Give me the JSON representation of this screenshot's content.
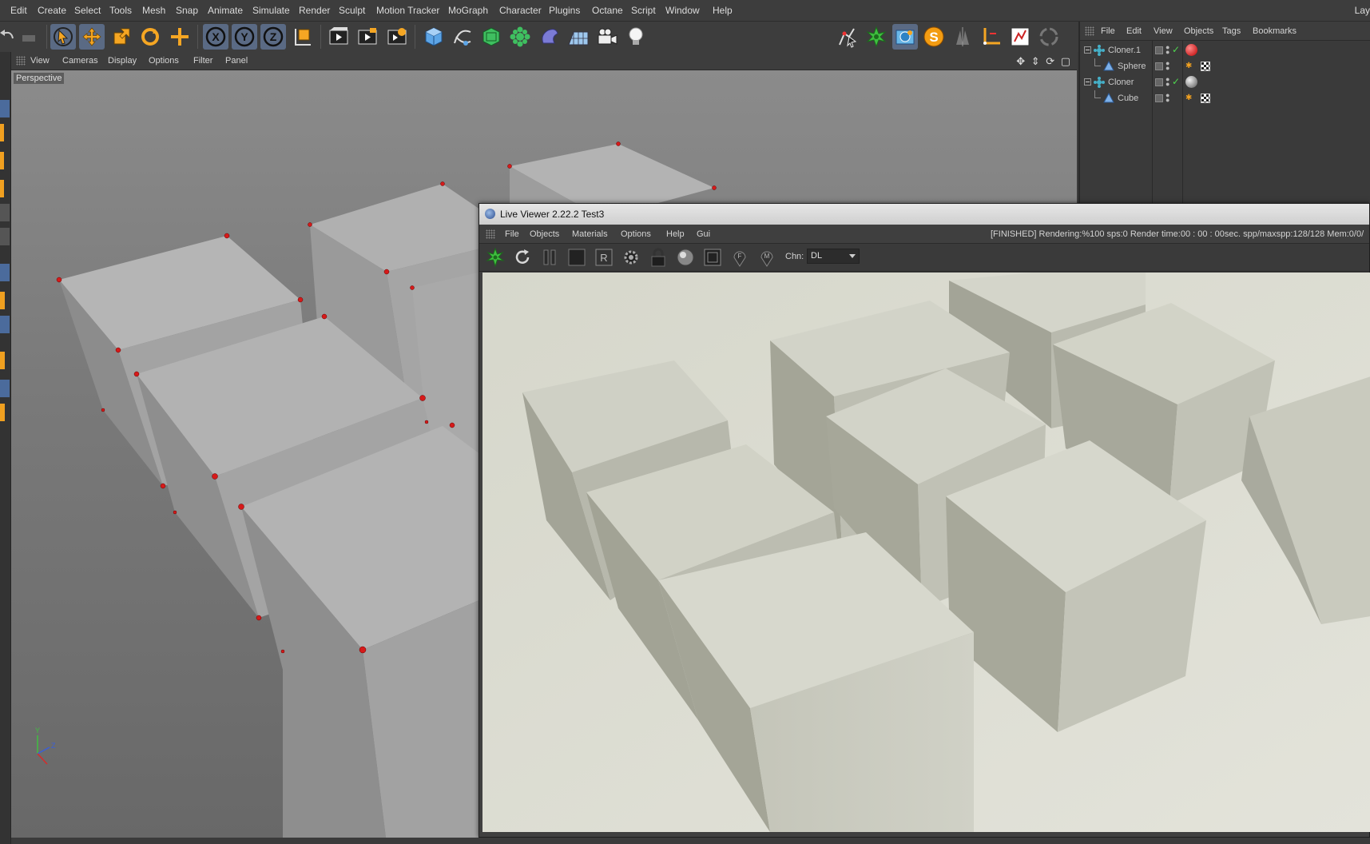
{
  "menubar": {
    "items": [
      "Edit",
      "Create",
      "Select",
      "Tools",
      "Mesh",
      "Snap",
      "Animate",
      "Simulate",
      "Render",
      "Sculpt",
      "Motion Tracker",
      "MoGraph",
      "Character",
      "Plugins",
      "Octane",
      "Script",
      "Window",
      "Help"
    ],
    "right_label": "Lay"
  },
  "toolbar": {
    "icons": [
      "undo-icon",
      "redo-icon",
      "live-selection-icon",
      "move-icon",
      "scale-icon",
      "rotate-icon",
      "add-object-icon",
      "x-axis-icon",
      "y-axis-icon",
      "z-axis-icon",
      "coordinate-system-icon",
      "render-view-icon",
      "render-picture-viewer-icon",
      "render-settings-icon",
      "cube-primitive-icon",
      "spline-pen-icon",
      "subdivision-surface-icon",
      "cloner-icon",
      "deformer-icon",
      "floor-icon",
      "camera-icon",
      "light-icon"
    ],
    "right_icons": [
      "tool-pointer-icon",
      "octane-live-viewer-icon",
      "octane-settings-icon",
      "s-plugin-icon",
      "symmetry-icon",
      "joint-icon",
      "material-icon",
      "recycle-icon"
    ]
  },
  "viewport": {
    "menu": [
      "View",
      "Cameras",
      "Display",
      "Options",
      "Filter",
      "Panel"
    ],
    "label": "Perspective"
  },
  "object_manager": {
    "menu": [
      "File",
      "Edit",
      "View",
      "Objects",
      "Tags",
      "Bookmarks"
    ],
    "objects": [
      {
        "name": "Cloner.1",
        "type": "cloner",
        "material": "red"
      },
      {
        "name": "Sphere",
        "type": "primitive",
        "material": "checker"
      },
      {
        "name": "Cloner",
        "type": "cloner",
        "material": "grey"
      },
      {
        "name": "Cube",
        "type": "primitive",
        "material": "checker"
      }
    ]
  },
  "live_viewer": {
    "title": "Live Viewer 2.22.2 Test3",
    "menu": [
      "File",
      "Objects",
      "Materials",
      "Options",
      "Help",
      "Gui"
    ],
    "status": "[FINISHED]  Rendering:%100 sps:0 Render time:00 : 00 : 00sec. spp/maxspp:128/128 Mem:0/0/",
    "buttons": [
      "send-scene-icon",
      "restart-icon",
      "pause-icon",
      "stop-icon",
      "region-render-icon",
      "settings-gear-icon",
      "lock-icon",
      "material-ball-icon",
      "clay-mode-icon",
      "focus-pick-icon",
      "material-pick-icon"
    ],
    "channel_label": "Chn:",
    "channel_value": "DL"
  },
  "colors": {
    "ui_bg": "#3d3d3d",
    "accent_orange": "#f0a020",
    "accent_blue": "#5a6a84",
    "render_bg": "#d9d9cf"
  }
}
